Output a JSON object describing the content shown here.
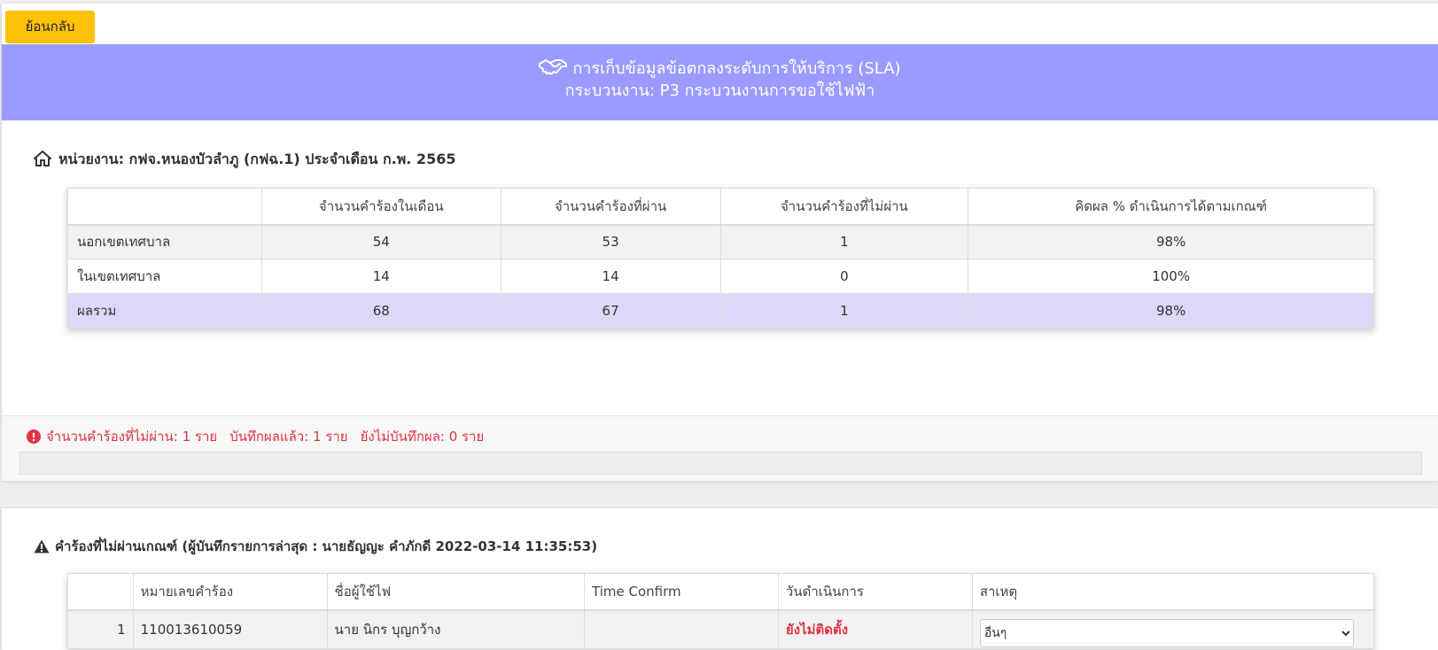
{
  "back_button": "ย้อนกลับ",
  "banner": {
    "title": "การเก็บข้อมูลข้อตกลงระดับการให้บริการ (SLA)",
    "subtitle": "กระบวนงาน: P3 กระบวนงานการขอใช้ไฟฟ้า",
    "icon": "handshake-icon"
  },
  "unit": {
    "title": "หน่วยงาน: กฟจ.หนองบัวลำภู (กฟฉ.1) ประจำเดือน ก.พ. 2565",
    "icon": "home-icon"
  },
  "summary_table": {
    "headers": [
      "",
      "จำนวนคำร้องในเดือน",
      "จำนวนคำร้องที่ผ่าน",
      "จำนวนคำร้องที่ไม่ผ่าน",
      "คิดผล % ดำเนินการได้ตามเกณฑ์"
    ],
    "rows": [
      [
        "นอกเขตเทศบาล",
        "54",
        "53",
        "1",
        "98%"
      ],
      [
        "ในเขตเทศบาล",
        "14",
        "14",
        "0",
        "100%"
      ],
      [
        "ผลรวม",
        "68",
        "67",
        "1",
        "98%"
      ]
    ]
  },
  "status": {
    "icon": "exclamation-circle-icon",
    "not_passed": "จำนวนคำร้องที่ไม่ผ่าน: 1 ราย",
    "recorded": "บันทึกผลแล้ว: 1 ราย",
    "not_recorded": "ยังไม่บันทึกผล: 0 ราย"
  },
  "failed_section": {
    "icon": "warning-triangle-icon",
    "title": "คำร้องที่ไม่ผ่านเกณฑ์ (ผู้บันทึกรายการล่าสุด : นายธัญญะ คำภักดี 2022-03-14 11:35:53)",
    "headers": [
      "",
      "หมายเลขคำร้อง",
      "ชื่อผู้ใช้ไฟ",
      "Time Confirm",
      "วันดำเนินการ",
      "สาเหตุ"
    ],
    "rows": [
      {
        "index": "1",
        "request_no": "110013610059",
        "customer": "นาย นิกร บุญกว้าง",
        "time_confirm": "",
        "action_date": "ยังไม่ติดตั้ง",
        "cause": "อื่นๆ"
      }
    ]
  },
  "colors": {
    "banner": "#9b9bff",
    "back_button": "#ffc107",
    "danger": "#dc3545",
    "total_row": "#dcd8f8"
  }
}
